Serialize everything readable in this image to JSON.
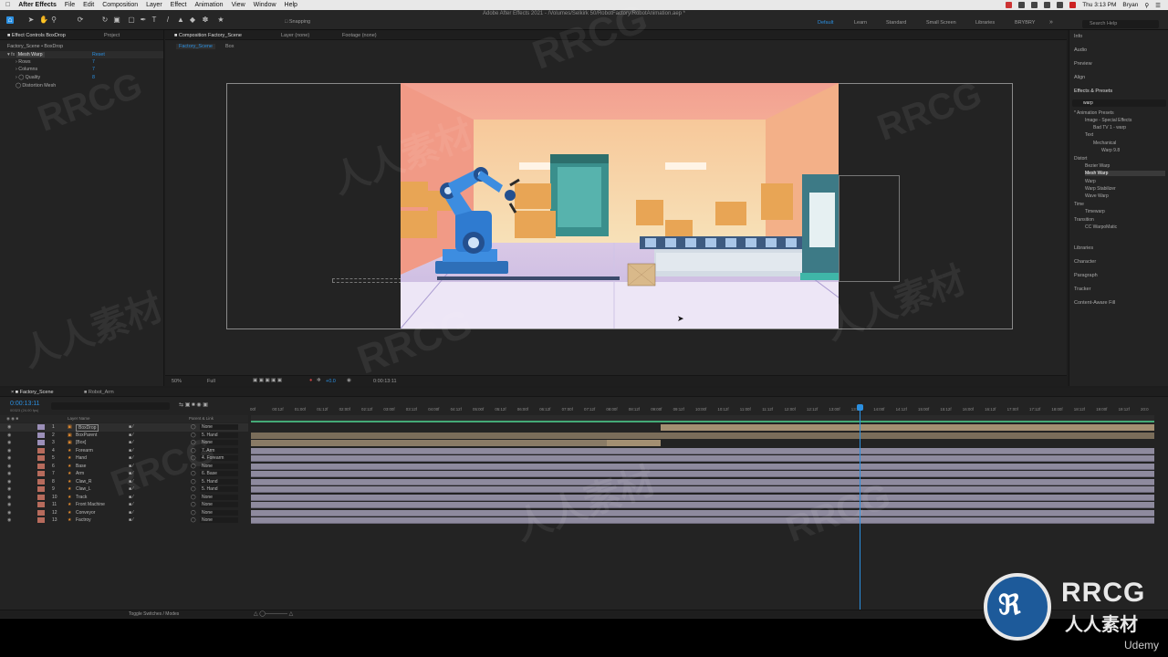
{
  "menubar": {
    "app": "After Effects",
    "items": [
      "File",
      "Edit",
      "Composition",
      "Layer",
      "Effect",
      "Animation",
      "View",
      "Window",
      "Help"
    ],
    "time": "Thu 3:13 PM",
    "user": "Bryan"
  },
  "window": {
    "title": "Adobe After Effects 2021 - /Volumes/Selkirk 50/RobotFactory/RobotAnimation.aep *"
  },
  "toolbar": {
    "snapping": "Snapping"
  },
  "workspaces": {
    "items": [
      "Default",
      "Learn",
      "Standard",
      "Small Screen",
      "Libraries",
      "BRYBRY"
    ],
    "search_placeholder": "Search Help"
  },
  "effect_controls": {
    "tabs": [
      "Effect Controls BoxDrop",
      "Project"
    ],
    "header": "Factory_Scene • BoxDrop",
    "effect": "Mesh Warp",
    "reset": "Reset",
    "params": [
      {
        "label": "Rows",
        "value": "7"
      },
      {
        "label": "Columns",
        "value": "7"
      },
      {
        "label": "Quality",
        "value": "8"
      },
      {
        "label": "Distortion Mesh",
        "value": ""
      }
    ]
  },
  "composition": {
    "tabs": [
      "Composition Factory_Scene",
      "Layer (none)",
      "Footage (none)"
    ],
    "subtabs": [
      "Factory_Scene",
      "Box"
    ],
    "zoom": "50%",
    "resolution": "Full",
    "timecode": "0:00:13:11",
    "exposure": "+0.0"
  },
  "right_panel": {
    "items_top": [
      "Info",
      "Audio",
      "Preview",
      "Align"
    ],
    "effects_presets": {
      "title": "Effects & Presets",
      "search": "warp",
      "tree": [
        "* Animation Presets",
        "Image - Special Effects",
        "Bad TV 1 - warp",
        "Text",
        "Mechanical",
        "Warp 9.8",
        "Distort",
        "Bezier Warp",
        "Mesh Warp",
        "Warp",
        "Warp Stabilizer",
        "Wave Warp",
        "Time",
        "Timewarp",
        "Transition",
        "CC WarpoMatic"
      ]
    },
    "items_bottom": [
      "Libraries",
      "Character",
      "Paragraph",
      "Tracker",
      "Content-Aware Fill"
    ]
  },
  "timeline": {
    "tabs": [
      "Factory_Scene",
      "Robot_Arm"
    ],
    "timecode": "0:00:13:11",
    "fps": "00323 (24.00 fps)",
    "col_source": "Layer Name",
    "col_parent": "Parent & Link",
    "ruler": [
      "00f",
      "00:12f",
      "01:00f",
      "01:12f",
      "02:00f",
      "02:12f",
      "03:00f",
      "03:12f",
      "04:00f",
      "04:12f",
      "05:00f",
      "05:12f",
      "06:00f",
      "06:12f",
      "07:00f",
      "07:12f",
      "08:00f",
      "08:12f",
      "09:00f",
      "09:12f",
      "10:00f",
      "10:12f",
      "11:00f",
      "11:12f",
      "12:00f",
      "12:12f",
      "13:00f",
      "13:12f",
      "14:00f",
      "14:12f",
      "15:00f",
      "15:12f",
      "16:00f",
      "16:12f",
      "17:00f",
      "17:12f",
      "18:00f",
      "18:12f",
      "19:00f",
      "19:12f",
      "20:0"
    ],
    "layers": [
      {
        "num": "1",
        "name": "BoxDrop",
        "parent": "None"
      },
      {
        "num": "2",
        "name": "BoxParent",
        "parent": "5. Hand"
      },
      {
        "num": "3",
        "name": "[Box]",
        "parent": "None"
      },
      {
        "num": "4",
        "name": "Forearm",
        "parent": "7. Arm"
      },
      {
        "num": "5",
        "name": "Hand",
        "parent": "4. Forearm"
      },
      {
        "num": "6",
        "name": "Base",
        "parent": "None"
      },
      {
        "num": "7",
        "name": "Arm",
        "parent": "6. Base"
      },
      {
        "num": "8",
        "name": "Claw_R",
        "parent": "5. Hand"
      },
      {
        "num": "9",
        "name": "Claw_L",
        "parent": "5. Hand"
      },
      {
        "num": "10",
        "name": "Track",
        "parent": "None"
      },
      {
        "num": "11",
        "name": "Front Machine",
        "parent": "None"
      },
      {
        "num": "12",
        "name": "Conveyor",
        "parent": "None"
      },
      {
        "num": "13",
        "name": "Factroy",
        "parent": "None"
      }
    ],
    "footer": "Toggle Switches / Modes"
  },
  "colors": {
    "accent": "#2b8fe0",
    "panel": "#232323",
    "layer_bar": "#8e8a9e",
    "bar_tan": "#a38f72"
  },
  "watermark": {
    "brand": "RRCG",
    "cn": "人人素材",
    "udemy": "Udemy"
  }
}
